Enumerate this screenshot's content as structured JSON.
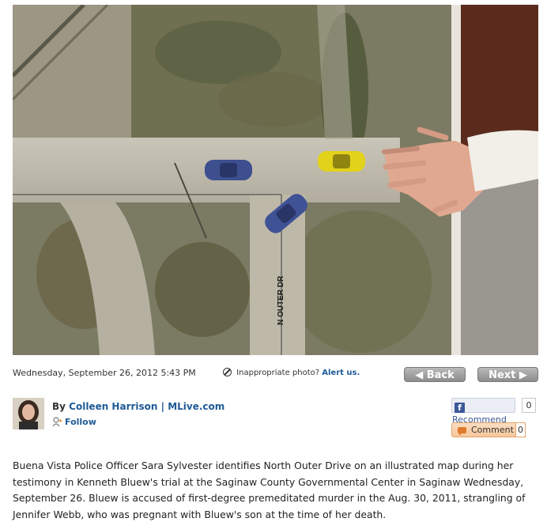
{
  "photo": {
    "road_label": "N OUTER DR",
    "alt_icon": "aerial-map-photo"
  },
  "meta": {
    "date": "Wednesday, September 26, 2012 5:43 PM",
    "report_text": "Inappropriate photo?",
    "report_link": "Alert us.",
    "back_label": "◀ Back",
    "next_label": "Next ▶"
  },
  "byline": {
    "by": "By",
    "author": "Colleen Harrison | MLive.com",
    "follow": "Follow"
  },
  "social": {
    "recommend_label": "Recommend",
    "recommend_count": "0",
    "comment_label": "Comment",
    "comment_count": "0"
  },
  "caption": "Buena Vista Police Officer Sara Sylvester identifies North Outer Drive on an illustrated map during her testimony in Kenneth Bluew's trial at the Saginaw County Governmental Center in Saginaw Wednesday, September 26. Bluew is accused of first-degree premeditated murder in the Aug. 30, 2011, strangling of Jennifer Webb, who was pregnant with Bluew's son at the time of her death.",
  "colors": {
    "link": "#1e5a97",
    "facebook": "#3b5998",
    "comment_accent": "#e0792c"
  }
}
